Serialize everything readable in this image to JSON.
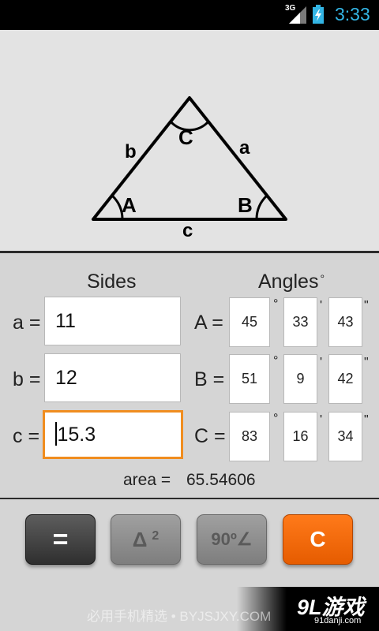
{
  "status": {
    "network": "3G",
    "time": "3:33"
  },
  "diagram": {
    "vertex_a": "A",
    "vertex_b": "B",
    "vertex_c": "C",
    "side_a": "a",
    "side_b": "b",
    "side_c": "c"
  },
  "sides": {
    "header": "Sides",
    "a": {
      "label": "a =",
      "value": "11"
    },
    "b": {
      "label": "b =",
      "value": "12"
    },
    "c": {
      "label": "c =",
      "value": "15.3"
    }
  },
  "angles": {
    "header": "Angles",
    "header_unit": "°",
    "unit_deg": "°",
    "unit_min": "'",
    "unit_sec": "\"",
    "A": {
      "label": "A =",
      "deg": "45",
      "min": "33",
      "sec": "43"
    },
    "B": {
      "label": "B =",
      "deg": "51",
      "min": "9",
      "sec": "42"
    },
    "C": {
      "label": "C =",
      "deg": "83",
      "min": "16",
      "sec": "34"
    }
  },
  "area": {
    "label": "area =",
    "value": "65.54606"
  },
  "buttons": {
    "equals": "=",
    "delta": "Δ",
    "delta_sup": "2",
    "right_angle": "90º∠",
    "clear": "C"
  },
  "watermark": {
    "text": "必用手机精选 • BYJSJXY.COM",
    "logo": "9L游戏",
    "logo_url": "91danji.com"
  },
  "colors": {
    "status_time": "#33b5e5",
    "focus_border": "#f08d1f",
    "clear_button": "#ff6a00"
  }
}
